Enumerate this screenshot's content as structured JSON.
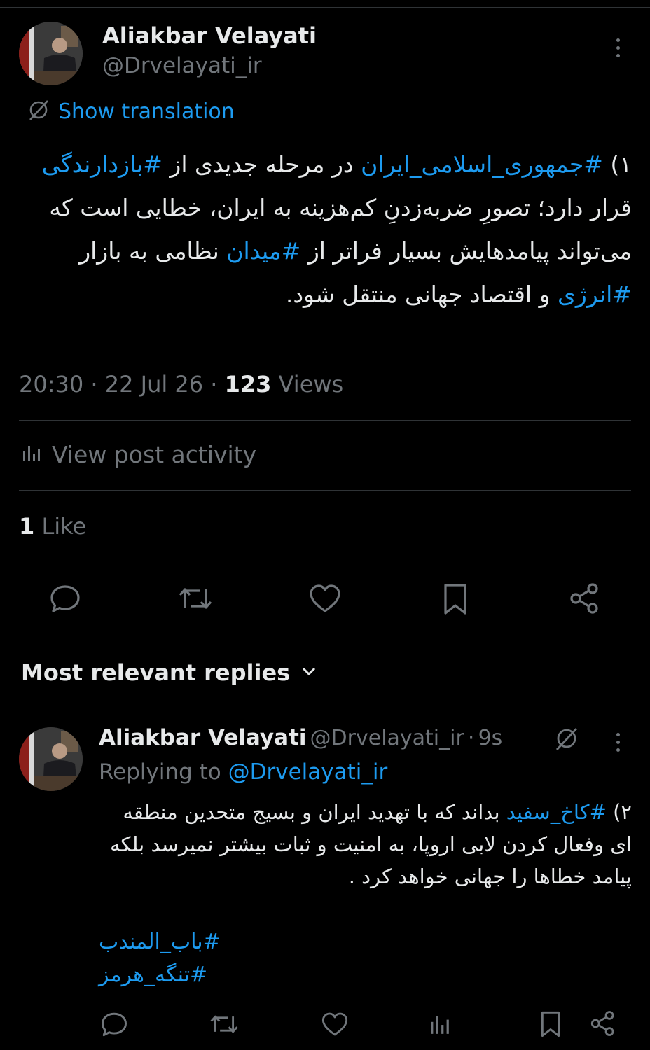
{
  "main_tweet": {
    "author_name": "Aliakbar Velayati",
    "author_handle": "@Drvelayati_ir",
    "show_translation": "Show translation",
    "text_parts": [
      {
        "t": "۱) ",
        "tag": false
      },
      {
        "t": "#جمهوری_اسلامی_ایران",
        "tag": true
      },
      {
        "t": " در مرحله جدیدی از ",
        "tag": false
      },
      {
        "t": "#بازدارندگی",
        "tag": true
      },
      {
        "t": " قرار دارد؛ تصورِ ضربه‌زدنِ کم‌هزینه به ایران، خطایی است که می‌تواند پیامدهایش بسیار فراتر از ",
        "tag": false
      },
      {
        "t": "#میدان",
        "tag": true
      },
      {
        "t": " نظامی به بازار ",
        "tag": false
      },
      {
        "t": "#انرژی",
        "tag": true
      },
      {
        "t": " و اقتصاد جهانی منتقل شود.",
        "tag": false
      }
    ],
    "time": "20:30",
    "date": "22 Jul 26",
    "views_count": "123",
    "views_label": "Views",
    "view_activity": "View post activity",
    "likes_count": "1",
    "likes_label": "Like"
  },
  "replies_header": {
    "label": "Most relevant replies"
  },
  "reply": {
    "author_name": "Aliakbar Velayati",
    "author_handle": "@Drvelayati_ir",
    "dot": "·",
    "age": "9s",
    "replying_prefix": "Replying to",
    "replying_handle": "@Drvelayati_ir",
    "text_parts": [
      {
        "t": "۲) ",
        "tag": false
      },
      {
        "t": "#کاخ_سفید",
        "tag": true
      },
      {
        "t": "  بداند که با تهدید ایران و بسیج متحدین منطقه ای وفعال کردن لابی اروپا، به امنیت و ثبات بیشتر نمیرسد بلکه پیامد خطاها را جهانی خواهد کرد .",
        "tag": false
      }
    ],
    "hashtags": [
      "#باب_المندب",
      "#تنگه_هرمز"
    ]
  },
  "colors": {
    "background": "#000000",
    "text": "#e7e9ea",
    "muted": "#71767b",
    "link": "#1d9bf0",
    "separator": "#2f3336"
  },
  "icons": {
    "translate": "globe-slash-icon",
    "activity": "bar-chart-icon",
    "reply": "speech-bubble-icon",
    "retweet": "retweet-icon",
    "like": "heart-icon",
    "bookmark": "bookmark-icon",
    "share": "share-icon",
    "more": "more-dots-icon",
    "chevron": "chevron-down-icon"
  }
}
